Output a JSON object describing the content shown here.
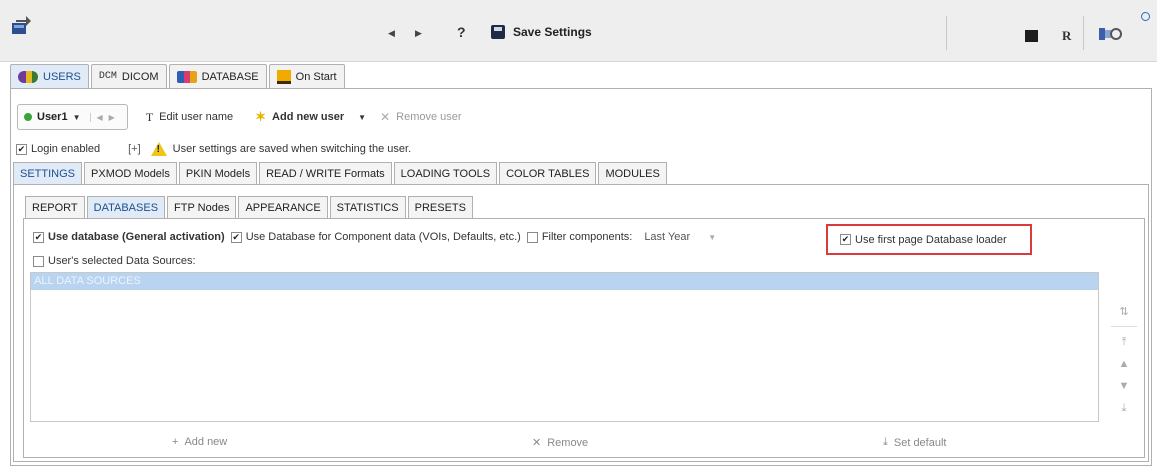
{
  "toolbar": {
    "help_label": "?",
    "save_label": "Save Settings",
    "r_label": "R"
  },
  "main_tabs": [
    {
      "label": "USERS",
      "icon": "users-icon",
      "active": true
    },
    {
      "label": "DICOM",
      "icon": "dcm-icon",
      "icon_text": "DCM"
    },
    {
      "label": "DATABASE",
      "icon": "database-icon"
    },
    {
      "label": "On Start",
      "icon": "on-start-icon"
    }
  ],
  "user": {
    "current": "User1",
    "edit_label": "Edit user name",
    "edit_icon": "T",
    "add_label": "Add new user",
    "remove_label": "Remove user"
  },
  "login": {
    "enabled_label": "Login enabled",
    "bracket": "[+]",
    "warning": "User settings are saved when switching the user."
  },
  "settings_tabs": [
    "SETTINGS",
    "PXMOD Models",
    "PKIN Models",
    "READ / WRITE Formats",
    "LOADING TOOLS",
    "COLOR TABLES",
    "MODULES"
  ],
  "sub_tabs": [
    "REPORT",
    "DATABASES",
    "FTP Nodes",
    "APPEARANCE",
    "STATISTICS",
    "PRESETS"
  ],
  "databases": {
    "use_db_label": "Use database (General activation)",
    "use_component_label": "Use Database for Component data (VOIs, Defaults, etc.)",
    "filter_label": "Filter components:",
    "filter_value": "Last Year",
    "first_page_label": "Use first page Database loader",
    "selected_sources_label": "User's selected Data Sources:",
    "list_items": [
      "ALL DATA SOURCES"
    ],
    "add_label": "Add new",
    "remove_label": "Remove",
    "default_label": "Set default"
  },
  "colors": {
    "highlight_border": "#d93a3a",
    "active_tab": "#e0ebf7",
    "selected_row": "#b9d4f1"
  }
}
